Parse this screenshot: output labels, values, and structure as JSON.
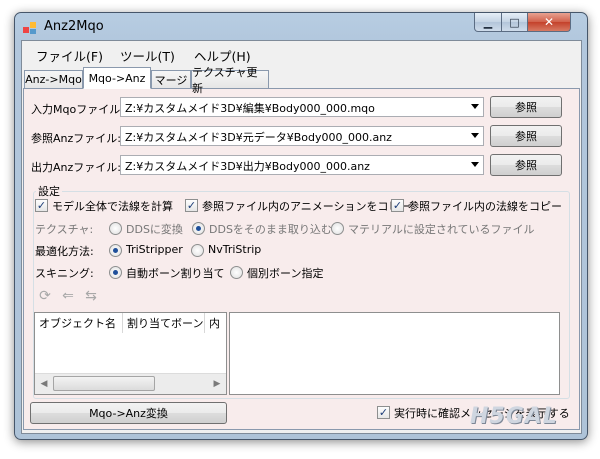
{
  "window": {
    "title": "Anz2Mqo"
  },
  "menu": [
    "ファイル(F)",
    "ツール(T)",
    "ヘルプ(H)"
  ],
  "tabs": [
    "Anz->Mqo",
    "Mqo->Anz",
    "マージ",
    "テクスチャ更新"
  ],
  "files": {
    "input_label": "入力Mqoファイル:",
    "input_value": "Z:¥カスタムメイド3D¥編集¥Body000_000.mqo",
    "ref_label": "参照Anzファイル:",
    "ref_value": "Z:¥カスタムメイド3D¥元データ¥Body000_000.anz",
    "output_label": "出力Anzファイル:",
    "output_value": "Z:¥カスタムメイド3D¥出力¥Body000_000.anz",
    "browse_label": "参照"
  },
  "settings": {
    "group_title": "設定",
    "chk_normals": "モデル全体で法線を計算",
    "chk_anim": "参照ファイル内のアニメーションをコピー",
    "chk_copy_normals": "参照ファイル内の法線をコピー",
    "texture_label": "テクスチャ:",
    "texture_opt1": "DDSに変換",
    "texture_opt2": "DDSをそのまま取り込む",
    "texture_opt3": "マテリアルに設定されているファイル",
    "opt_label": "最適化方法:",
    "opt_opt1": "TriStripper",
    "opt_opt2": "NvTriStrip",
    "skin_label": "スキニング:",
    "skin_opt1": "自動ボーン割り当て",
    "skin_opt2": "個別ボーン指定"
  },
  "list": {
    "columns": [
      "オブジェクト名",
      "割り当てボーン",
      "内"
    ]
  },
  "footer": {
    "convert_button": "Mqo->Anz変換",
    "confirm_label": "実行時に確認メッセージを表示する"
  },
  "watermark": "H5GAL"
}
